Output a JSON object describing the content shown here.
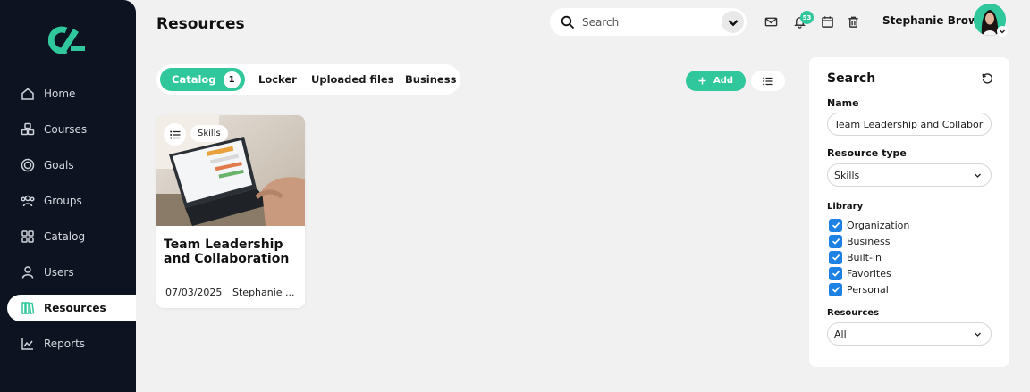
{
  "sidebar": {
    "items": [
      {
        "label": "Home",
        "icon": "home-icon"
      },
      {
        "label": "Courses",
        "icon": "courses-icon"
      },
      {
        "label": "Goals",
        "icon": "goals-icon"
      },
      {
        "label": "Groups",
        "icon": "groups-icon"
      },
      {
        "label": "Catalog",
        "icon": "catalog-icon"
      },
      {
        "label": "Users",
        "icon": "users-icon"
      },
      {
        "label": "Resources",
        "icon": "resources-icon",
        "active": true
      },
      {
        "label": "Reports",
        "icon": "reports-icon"
      }
    ]
  },
  "header": {
    "title": "Resources",
    "search_placeholder": "Search",
    "notification_count": "53",
    "user_name": "Stephanie Brown"
  },
  "tabs": [
    {
      "label": "Catalog",
      "count": "1",
      "active": true
    },
    {
      "label": "Locker"
    },
    {
      "label": "Uploaded files"
    },
    {
      "label": "Business"
    }
  ],
  "toolbar": {
    "add_label": "Add"
  },
  "cards": [
    {
      "tag": "Skills",
      "title": "Team Leadership and Collaboration",
      "date": "07/03/2025",
      "author": "Stephanie ..."
    }
  ],
  "filters": {
    "title": "Search",
    "name_label": "Name",
    "name_value": "Team Leadership and Collaboration",
    "type_label": "Resource type",
    "type_value": "Skills",
    "library_label": "Library",
    "library_options": [
      {
        "label": "Organization",
        "checked": true
      },
      {
        "label": "Business",
        "checked": true
      },
      {
        "label": "Built-in",
        "checked": true
      },
      {
        "label": "Favorites",
        "checked": true
      },
      {
        "label": "Personal",
        "checked": true
      }
    ],
    "resources_label": "Resources",
    "resources_value": "All"
  },
  "colors": {
    "accent": "#2fc79b",
    "sidebar": "#0d1321",
    "checkbox": "#1e82e5"
  }
}
